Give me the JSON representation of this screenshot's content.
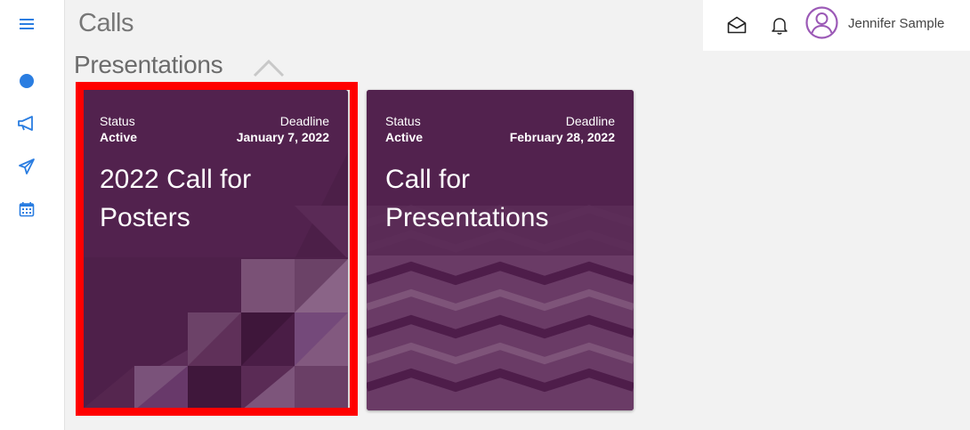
{
  "sidebar": {
    "items": [
      {
        "icon": "menu-icon"
      },
      {
        "icon": "dashboard-dot-icon"
      },
      {
        "icon": "megaphone-icon"
      },
      {
        "icon": "paper-plane-icon"
      },
      {
        "icon": "calendar-icon"
      }
    ],
    "accent": "#2a7de1"
  },
  "header": {
    "title": "Calls"
  },
  "section": {
    "title": "Presentations"
  },
  "topbar": {
    "icons": [
      "mail-open-icon",
      "bell-icon"
    ],
    "user_name": "Jennifer Sample",
    "avatar_color": "#9b59b6"
  },
  "cards": [
    {
      "status_label": "Status",
      "status_value": "Active",
      "deadline_label": "Deadline",
      "deadline_value": "January 7, 2022",
      "title": "2022 Call for Posters",
      "pattern": "triangles"
    },
    {
      "status_label": "Status",
      "status_value": "Active",
      "deadline_label": "Deadline",
      "deadline_value": "February 28, 2022",
      "title": "Call for Presentations",
      "pattern": "chevrons"
    }
  ],
  "colors": {
    "card_bg": "#52224e",
    "highlight": "#ff0000"
  }
}
